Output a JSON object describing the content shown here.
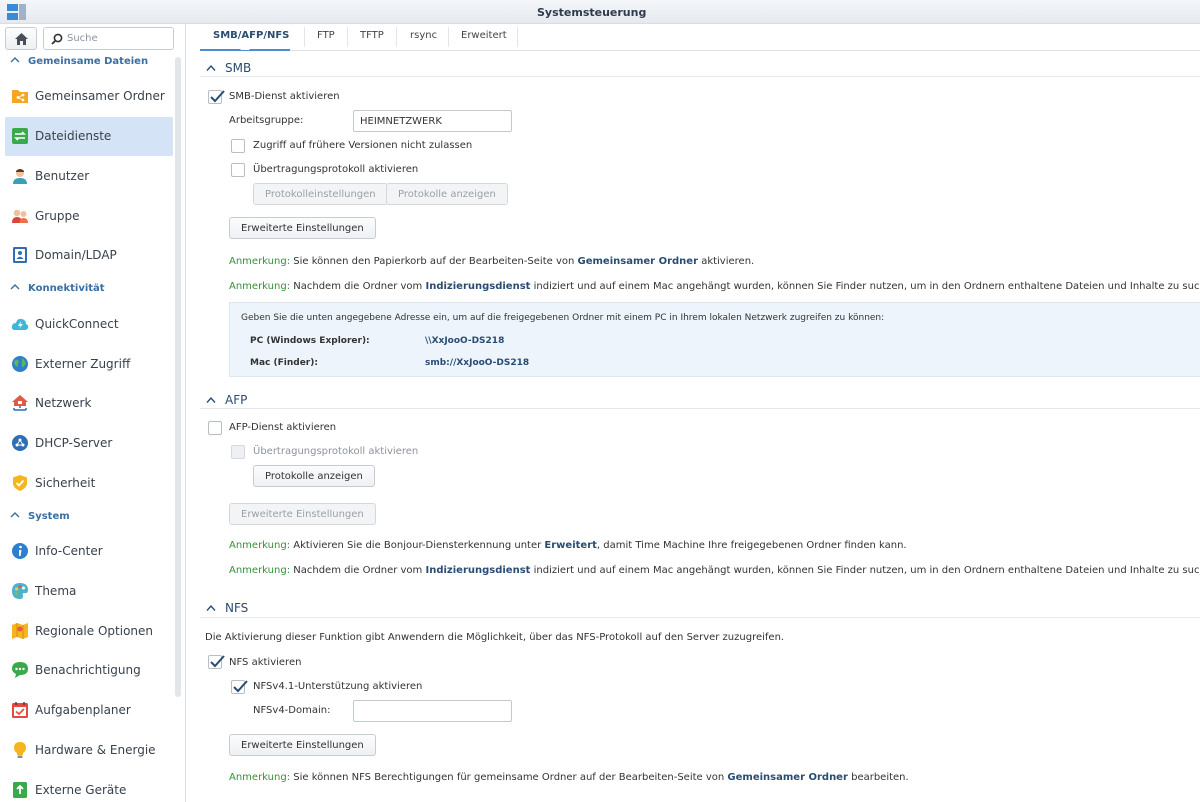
{
  "window": {
    "title": "Systemsteuerung"
  },
  "sidebar": {
    "search_placeholder": "Suche",
    "categories": {
      "shared": "Gemeinsame Dateien",
      "connectivity": "Konnektivität",
      "system": "System"
    },
    "items": [
      {
        "label": "Gemeinsamer Ordner",
        "icon": "shared-folder-icon"
      },
      {
        "label": "Dateidienste",
        "icon": "file-services-icon",
        "active": true
      },
      {
        "label": "Benutzer",
        "icon": "user-icon"
      },
      {
        "label": "Gruppe",
        "icon": "group-icon"
      },
      {
        "label": "Domain/LDAP",
        "icon": "domain-icon"
      },
      {
        "label": "QuickConnect",
        "icon": "quickconnect-cloud-icon"
      },
      {
        "label": "Externer Zugriff",
        "icon": "external-access-globe-icon"
      },
      {
        "label": "Netzwerk",
        "icon": "network-house-icon"
      },
      {
        "label": "DHCP-Server",
        "icon": "dhcp-server-icon"
      },
      {
        "label": "Sicherheit",
        "icon": "security-shield-icon"
      },
      {
        "label": "Info-Center",
        "icon": "info-center-icon"
      },
      {
        "label": "Thema",
        "icon": "theme-palette-icon"
      },
      {
        "label": "Regionale Optionen",
        "icon": "regional-options-icon"
      },
      {
        "label": "Benachrichtigung",
        "icon": "notification-bubble-icon"
      },
      {
        "label": "Aufgabenplaner",
        "icon": "task-scheduler-calendar-icon"
      },
      {
        "label": "Hardware & Energie",
        "icon": "hardware-bulb-icon"
      },
      {
        "label": "Externe Geräte",
        "icon": "external-devices-icon"
      }
    ]
  },
  "tabs": [
    "SMB/AFP/NFS",
    "FTP",
    "TFTP",
    "rsync",
    "Erweitert"
  ],
  "smb": {
    "title": "SMB",
    "enable": "SMB-Dienst aktivieren",
    "workgroup_label": "Arbeitsgruppe:",
    "workgroup_value": "HEIMNETZWERK",
    "no_previous_versions": "Zugriff auf frühere Versionen nicht zulassen",
    "transfer_log": "Übertragungsprotokoll aktivieren",
    "log_settings_btn": "Protokolleinstellungen",
    "show_logs_btn": "Protokolle anzeigen",
    "advanced_btn": "Erweiterte Einstellungen",
    "note_label": "Anmerkung:",
    "note1_pre": "Sie können den Papierkorb auf der Bearbeiten-Seite von",
    "note1_bold": "Gemeinsamer Ordner",
    "note1_post": "aktivieren.",
    "note2_pre": "Nachdem die Ordner vom",
    "note2_bold": "Indizierungsdienst",
    "note2_post": "indiziert und auf einem Mac angehängt wurden, können Sie Finder nutzen, um in den Ordnern enthaltene Dateien und Inhalte zu suchen.",
    "info_text": "Geben Sie die unten angegebene Adresse ein, um auf die freigegebenen Ordner mit einem PC in Ihrem lokalen Netzwerk zugreifen zu können:",
    "pc_label": "PC (Windows Explorer):",
    "pc_value": "\\\\XxJooO-DS218",
    "mac_label": "Mac (Finder):",
    "mac_value": "smb://XxJooO-DS218"
  },
  "afp": {
    "title": "AFP",
    "enable": "AFP-Dienst aktivieren",
    "transfer_log": "Übertragungsprotokoll aktivieren",
    "show_logs_btn": "Protokolle anzeigen",
    "advanced_btn": "Erweiterte Einstellungen",
    "note_label": "Anmerkung:",
    "note1_pre": "Aktivieren Sie die Bonjour-Diensterkennung unter",
    "note1_bold": "Erweitert",
    "note1_post": ", damit Time Machine Ihre freigegebenen Ordner finden kann.",
    "note2_pre": "Nachdem die Ordner vom",
    "note2_bold": "Indizierungsdienst",
    "note2_post": "indiziert und auf einem Mac angehängt wurden, können Sie Finder nutzen, um in den Ordnern enthaltene Dateien und Inhalte zu suchen."
  },
  "nfs": {
    "title": "NFS",
    "description": "Die Aktivierung dieser Funktion gibt Anwendern die Möglichkeit, über das NFS-Protokoll auf den Server zuzugreifen.",
    "enable": "NFS aktivieren",
    "v41": "NFSv4.1-Unterstützung aktivieren",
    "domain_label": "NFSv4-Domain:",
    "domain_value": "",
    "advanced_btn": "Erweiterte Einstellungen",
    "note_label": "Anmerkung:",
    "note1_pre": "Sie können NFS Berechtigungen für gemeinsame Ordner auf der Bearbeiten-Seite von",
    "note1_bold": "Gemeinsamer Ordner",
    "note1_post": "bearbeiten."
  },
  "colors": {
    "accent": "#4a8bd4",
    "note_green": "#35913a",
    "heading_blue": "#2a4c73",
    "active_bg": "#d4e3f5"
  }
}
